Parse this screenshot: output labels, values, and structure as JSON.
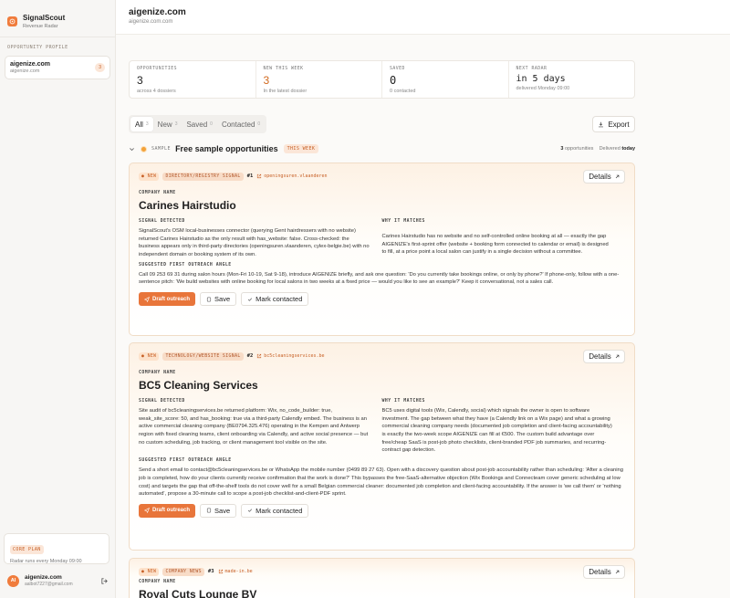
{
  "brand": {
    "name": "SignalScout",
    "subtitle": "Revenue Radar"
  },
  "sidebar": {
    "section_label": "OPPORTUNITY PROFILE",
    "profile": {
      "name": "aigenize.com",
      "domain": "aigenize.com",
      "count": "3"
    },
    "plan": {
      "badge": "CORE PLAN",
      "text": "Radar runs every Monday 09:00"
    },
    "user": {
      "initials": "AI",
      "name": "aigenize.com",
      "email": "aalbot7227@gmail.com"
    }
  },
  "header": {
    "title": "aigenize.com",
    "subtitle": "aigenize.com.com"
  },
  "stats": [
    {
      "label": "OPPORTUNITIES",
      "value": "3",
      "sub": "across 4 dossiers"
    },
    {
      "label": "NEW THIS WEEK",
      "value": "3",
      "sub": "In the latest dossier"
    },
    {
      "label": "SAVED",
      "value": "0",
      "sub": "0 contacted"
    },
    {
      "label": "NEXT RADAR",
      "value": "in 5 days",
      "sub": "delivered Monday 09:00"
    }
  ],
  "filters": [
    {
      "label": "All",
      "count": "3"
    },
    {
      "label": "New",
      "count": "3"
    },
    {
      "label": "Saved",
      "count": "0"
    },
    {
      "label": "Contacted",
      "count": "0"
    }
  ],
  "export_label": "Export",
  "sample": {
    "label": "SAMPLE",
    "title": "Free sample opportunities",
    "badge": "THIS WEEK",
    "count": "3",
    "count_suffix": "opportunities",
    "delivered_prefix": "Delivered",
    "delivered": "today"
  },
  "labels": {
    "company_name": "COMPANY NAME",
    "signal_detected": "SIGNAL DETECTED",
    "why_matches": "WHY IT MATCHES",
    "outreach_angle": "SUGGESTED FIRST OUTREACH ANGLE",
    "details": "Details",
    "draft": "Draft outreach",
    "save": "Save",
    "mark": "Mark contacted",
    "new": "NEW"
  },
  "cards": [
    {
      "tag": "DIRECTORY/REGISTRY SIGNAL",
      "rank": "#1",
      "link": "openingsuren.vlaanderen",
      "company": "Carines Hairstudio",
      "signal": "SignalScout's OSM local-businesses connector (querying Gent hairdressers with no website) returned Carines Hairstudio as the only result with has_website: false. Cross-checked: the business appears only in third-party directories (openingsuren.vlaanderen, cylex-belgie.be) with no independent domain or booking system of its own.",
      "why": "Carines Hairstudio has no website and no self-controlled online booking at all — exactly the gap AIGENIZE's first-sprint offer (website + booking form connected to calendar or email) is designed to fill, at a price point a local salon can justify in a single decision without a committee.",
      "outreach": "Call 09 253 69 31 during salon hours (Mon-Fri 10-19, Sat 9-18), introduce AIGENIZE briefly, and ask one question: 'Do you currently take bookings online, or only by phone?' If phone-only, follow with a one-sentence pitch: 'We build websites with online booking for local salons in two weeks at a fixed price — would you like to see an example?' Keep it conversational, not a sales call."
    },
    {
      "tag": "TECHNOLOGY/WEBSITE SIGNAL",
      "rank": "#2",
      "link": "bc5cleaningservices.be",
      "company": "BC5 Cleaning Services",
      "signal": "Site audit of bc5cleaningservices.be returned platform: Wix, no_code_builder: true, weak_site_score: 50, and has_booking: true via a third-party Calendly embed. The business is an active commercial cleaning company (BE0794.325.476) operating in the Kempen and Antwerp region with fixed cleaning teams, client onboarding via Calendly, and active social presence — but no custom scheduling, job tracking, or client management tool visible on the site.",
      "why": "BC5 uses digital tools (Wix, Calendly, social) which signals the owner is open to software investment. The gap between what they have (a Calendly link on a Wix page) and what a growing commercial cleaning company needs (documented job completion and client-facing accountability) is exactly the two-week scope AIGENIZE can fill at €500. The custom build advantage over free/cheap SaaS is post-job photo checklists, client-branded PDF job summaries, and recurring-contract gap detection.",
      "outreach": "Send a short email to contact@bc5cleaningservices.be or WhatsApp the mobile number (0499 89 27 63). Open with a discovery question about post-job accountability rather than scheduling: 'After a cleaning job is completed, how do your clients currently receive confirmation that the work is done?' This bypasses the free-SaaS-alternative objection (Wix Bookings and Connecteam cover generic scheduling at low cost) and targets the gap that off-the-shelf tools do not cover well for a small Belgian commercial cleaner: documented job completion and client-facing accountability. If the answer is 'we call them' or 'nothing automated', propose a 30-minute call to scope a post-job checklist-and-client-PDF sprint."
    },
    {
      "tag": "COMPANY NEWS",
      "rank": "#3",
      "link": "made-in.be",
      "company": "Royal Cuts Lounge BV"
    }
  ]
}
